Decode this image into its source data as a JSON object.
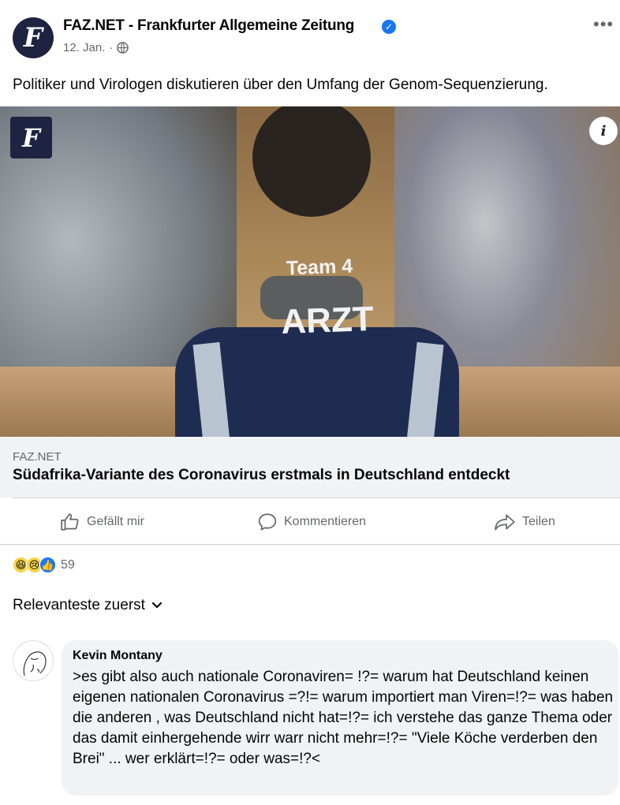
{
  "post": {
    "page_name": "FAZ.NET - Frankfurter Allgemeine Zeitung",
    "avatar_letter": "F",
    "verified_icon": "verified-check-icon",
    "date": "12. Jan.",
    "separator": "·",
    "audience_icon": "globe-icon",
    "more_icon": "more-options-icon",
    "text": "Politiker und Virologen diskutieren über den Umfang der Genom-Sequenzierung."
  },
  "link": {
    "badge_letter": "F",
    "info_label": "i",
    "photo_text_line1": "Team 4",
    "photo_text_line2": "ARZT",
    "domain": "FAZ.NET",
    "title": "Südafrika-Variante des Coronavirus erstmals in Deutschland entdeckt"
  },
  "actions": {
    "like_label": "Gefällt mir",
    "comment_label": "Kommentieren",
    "share_label": "Teilen"
  },
  "reactions": {
    "emojis": [
      "😆",
      "😢",
      "👍"
    ],
    "count": "59"
  },
  "comments_sort": {
    "label": "Relevanteste zuerst"
  },
  "comment": {
    "author": "Kevin Montany",
    "text": ">es gibt also auch nationale Coronaviren= !?= warum hat Deutschland keinen eigenen nationalen Coronavirus =?!= warum importiert man Viren=!?= was haben die anderen , was Deutschland nicht hat=!?= ich verstehe das ganze Thema oder das damit einhergehende wirr warr nicht mehr=!?= \"Viele Köche  verderben den Brei\" ... wer erklärt=!?=  oder was=!?<"
  },
  "colors": {
    "brand_navy": "#1d2340",
    "verified_blue": "#1877f2",
    "secondary_text": "#65676b",
    "bubble_bg": "#f0f2f5"
  }
}
